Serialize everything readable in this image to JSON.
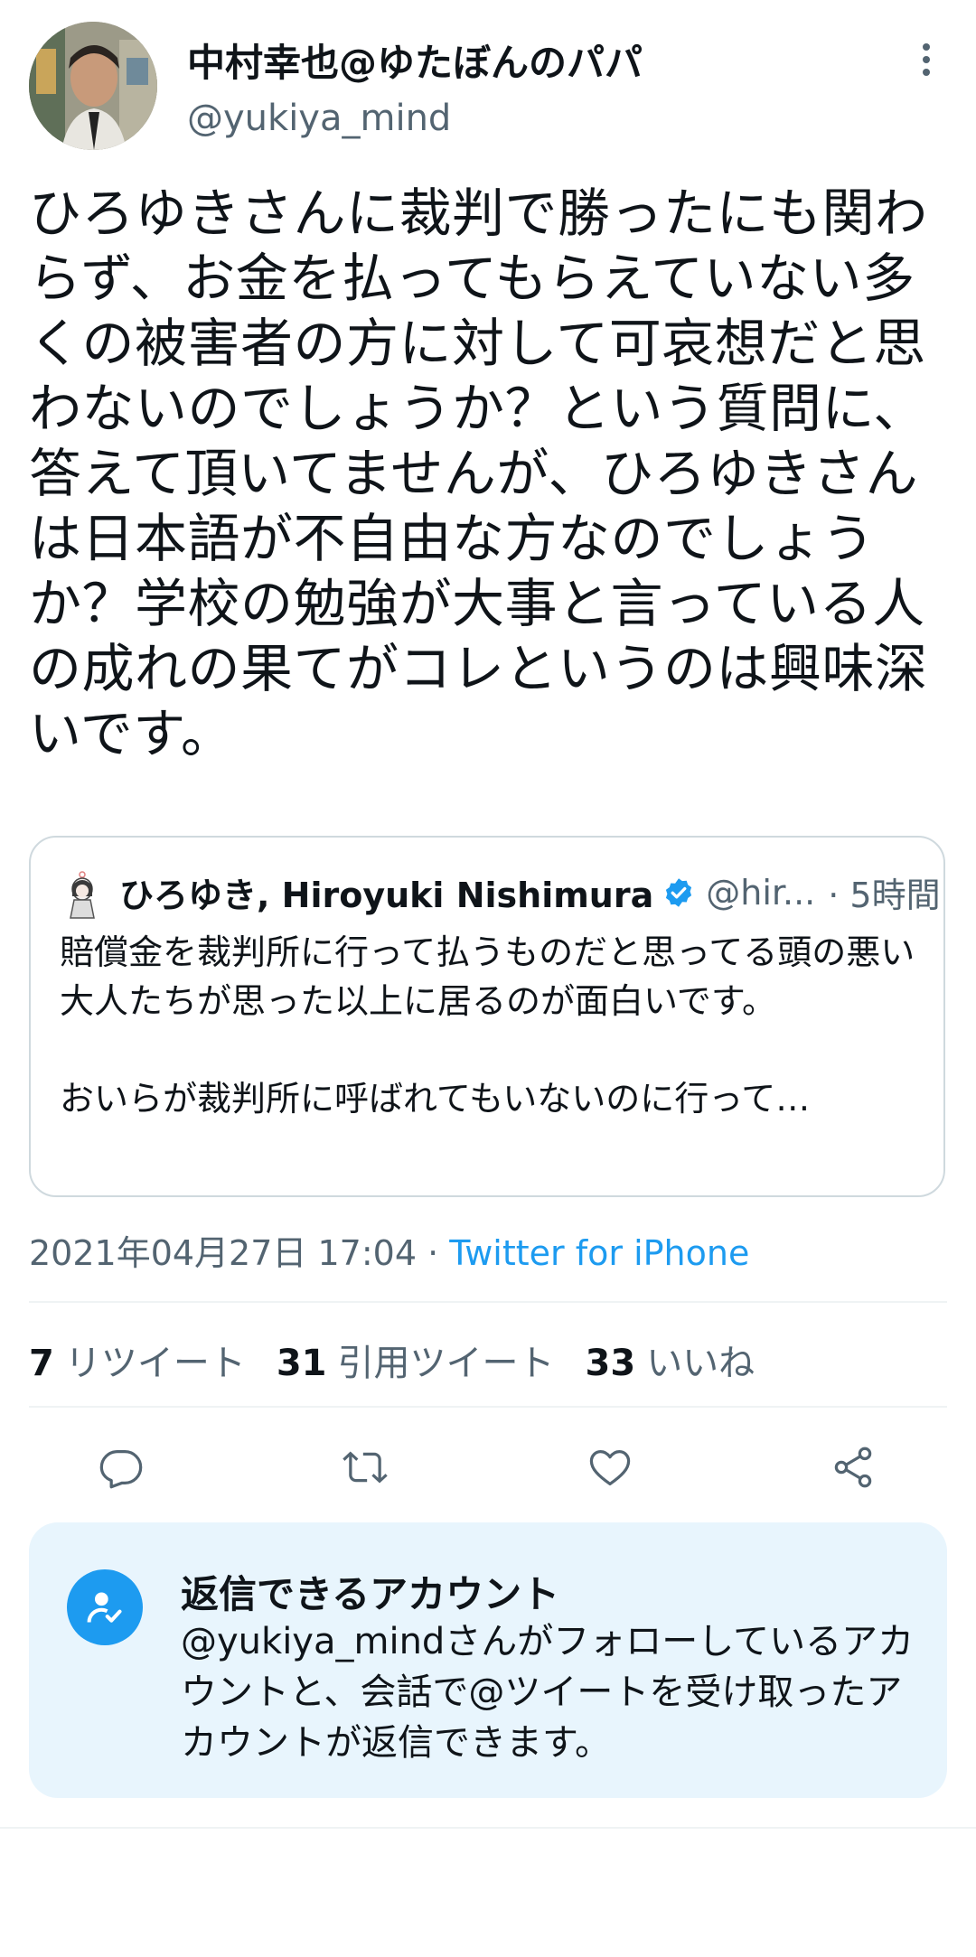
{
  "author": {
    "display_name": "中村幸也@ゆたぼんのパパ",
    "handle": "@yukiya_mind",
    "avatar_icon": "avatar-photo"
  },
  "tweet": {
    "text": "ひろゆきさんに裁判で勝ったにも関わらず、お金を払ってもらえていない多くの被害者の方に対して可哀想だと思わないのでしょうか？という質問に、答えて頂いてませんが、ひろゆきさんは日本語が不自由な方なのでしょうか？学校の勉強が大事と言っている人の成れの果てがコレというのは興味深いです。"
  },
  "quote": {
    "name": "ひろゆき, Hiroyuki Nishimura",
    "handle": "@hir...",
    "time": "· 5時間",
    "text": "賠償金を裁判所に行って払うものだと思ってる頭の悪い大人たちが思った以上に居るのが面白いです。\n\nおいらが裁判所に呼ばれてもいないのに行って…",
    "verified_icon": "verified-badge-icon"
  },
  "meta": {
    "timestamp": "2021年04月27日 17:04",
    "separator": "·",
    "source": "Twitter for iPhone"
  },
  "stats": {
    "retweets_count": "7",
    "retweets_label": "リツイート",
    "quotes_count": "31",
    "quotes_label": "引用ツイート",
    "likes_count": "33",
    "likes_label": "いいね"
  },
  "actions": [
    "reply-icon",
    "retweet-icon",
    "like-icon",
    "share-icon"
  ],
  "reply_info": {
    "title": "返信できるアカウント",
    "description": "@yukiya_mindさんがフォローしているアカウントと、会話で@ツイートを受け取ったアカウントが返信できます。"
  },
  "colors": {
    "accent": "#1d9bf0",
    "text_primary": "#0f1419",
    "text_secondary": "#536471",
    "border": "#cfd9de",
    "reply_box_bg": "#e8f5fd"
  }
}
